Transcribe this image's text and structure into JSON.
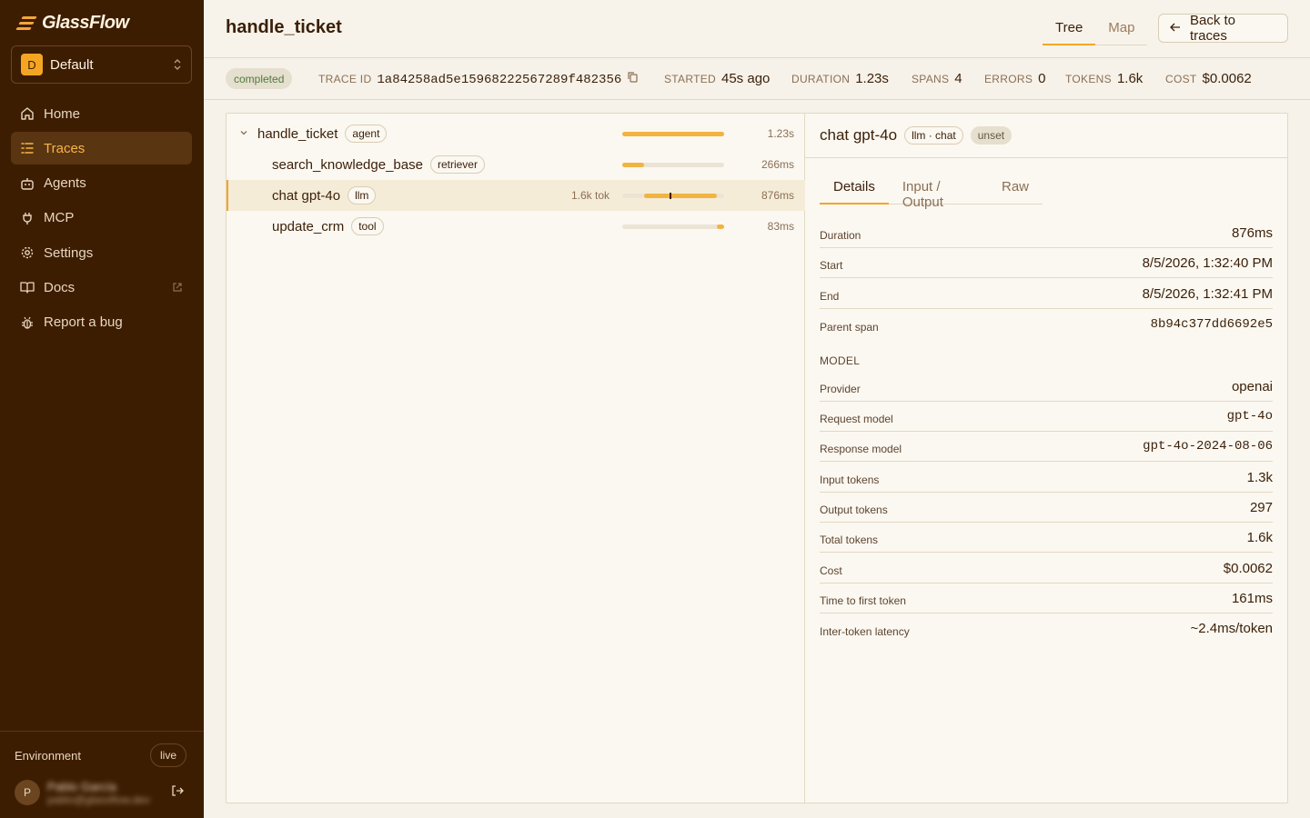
{
  "brand": {
    "name": "GlassFlow"
  },
  "workspace": {
    "initial": "D",
    "name": "Default"
  },
  "nav": [
    {
      "label": "Home",
      "icon": "home-icon",
      "active": false
    },
    {
      "label": "Traces",
      "icon": "list-icon",
      "active": true
    },
    {
      "label": "Agents",
      "icon": "bot-icon",
      "active": false
    },
    {
      "label": "MCP",
      "icon": "plug-icon",
      "active": false
    },
    {
      "label": "Settings",
      "icon": "gear-icon",
      "active": false
    },
    {
      "label": "Docs",
      "icon": "book-icon",
      "active": false,
      "external": true
    },
    {
      "label": "Report a bug",
      "icon": "bug-icon",
      "active": false
    }
  ],
  "environment": {
    "label": "Environment",
    "value": "live"
  },
  "user": {
    "initial": "P",
    "name": "Pablo García",
    "email": "pablo@glassflow.dev"
  },
  "header": {
    "title": "handle_ticket",
    "tabs": [
      "Tree",
      "Map"
    ],
    "active_tab": "Tree",
    "back_label": "Back to traces"
  },
  "trace": {
    "status": "completed",
    "trace_id_label": "TRACE ID",
    "trace_id": "1a84258ad5e15968222567289f482356",
    "started_label": "STARTED",
    "started": "45s ago",
    "duration_label": "DURATION",
    "duration": "1.23s",
    "spans_label": "SPANS",
    "spans": "4",
    "errors_label": "ERRORS",
    "errors": "0",
    "tokens_label": "TOKENS",
    "tokens": "1.6k",
    "cost_label": "COST",
    "cost": "$0.0062"
  },
  "spans": [
    {
      "name": "handle_ticket",
      "kind": "agent",
      "duration": "1.23s",
      "tokens": "",
      "start_frac": 0.0,
      "width_frac": 1.0,
      "depth": 0,
      "expanded": true,
      "selected": false
    },
    {
      "name": "search_knowledge_base",
      "kind": "retriever",
      "duration": "266ms",
      "tokens": "",
      "start_frac": 0.0,
      "width_frac": 0.216,
      "depth": 1,
      "selected": false
    },
    {
      "name": "chat gpt-4o",
      "kind": "llm",
      "duration": "876ms",
      "tokens": "1.6k tok",
      "start_frac": 0.216,
      "width_frac": 0.712,
      "first_token_frac": 0.347,
      "depth": 1,
      "selected": true
    },
    {
      "name": "update_crm",
      "kind": "tool",
      "duration": "83ms",
      "tokens": "",
      "start_frac": 0.932,
      "width_frac": 0.067,
      "depth": 1,
      "selected": false
    }
  ],
  "detail": {
    "title": "chat gpt-4o",
    "kind_pill": "llm · chat",
    "status_pill": "unset",
    "tabs": [
      "Details",
      "Input / Output",
      "Raw"
    ],
    "active_tab": "Details",
    "timing": [
      {
        "k": "Duration",
        "v": "876ms"
      },
      {
        "k": "Start",
        "v": "8/5/2026, 1:32:40 PM"
      },
      {
        "k": "End",
        "v": "8/5/2026, 1:32:41 PM"
      },
      {
        "k": "Parent span",
        "v": "8b94c377dd6692e5"
      }
    ],
    "model_section": "MODEL",
    "model": [
      {
        "k": "Provider",
        "v": "openai"
      },
      {
        "k": "Request model",
        "v": "gpt-4o"
      },
      {
        "k": "Response model",
        "v": "gpt-4o-2024-08-06"
      },
      {
        "k": "Input tokens",
        "v": "1.3k"
      },
      {
        "k": "Output tokens",
        "v": "297"
      },
      {
        "k": "Total tokens",
        "v": "1.6k"
      },
      {
        "k": "Cost",
        "v": "$0.0062"
      },
      {
        "k": "Time to first token",
        "v": "161ms"
      },
      {
        "k": "Inter-token latency",
        "v": "~2.4ms/token"
      }
    ]
  },
  "colors": {
    "sidebar_bg": "#3d1d02",
    "accent": "#f4a623",
    "page_bg": "#f6f2e9",
    "success_text": "#4f7a3a"
  }
}
